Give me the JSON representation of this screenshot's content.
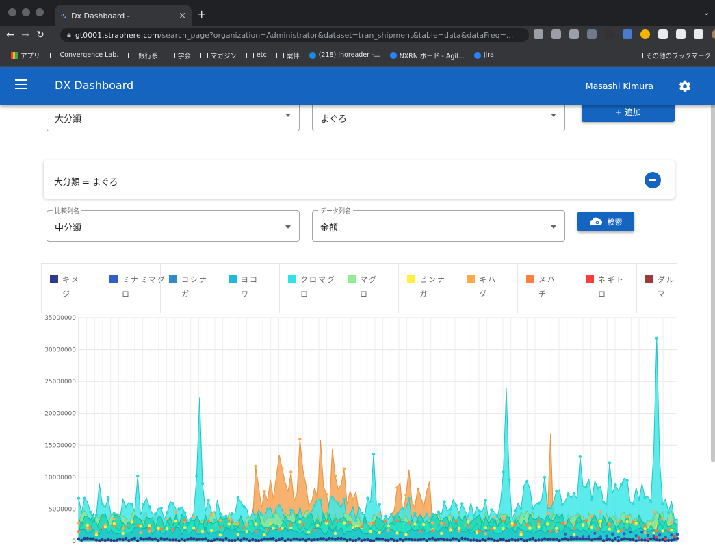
{
  "browser": {
    "tab_title": "Dx Dashboard -",
    "url_host": "gt0001.straphere.com",
    "url_path": "/search_page?organization=Administrator&dataset=tran_shipment&table=data&dataFreq=...",
    "bookmarks": [
      "アプリ",
      "Convergence Lab.",
      "銀行系",
      "学会",
      "マガジン",
      "etc",
      "案件",
      "(218) Inoreader -...",
      "NXRN ボード - Agil...",
      "Jira"
    ],
    "bookmarks_other": "その他のブックマーク"
  },
  "appbar": {
    "title": "DX Dashboard",
    "user": "Masashi Kimura"
  },
  "filters": {
    "column_value": "大分類",
    "value_value": "まぐろ",
    "add_label": "+ 追加",
    "condition": "大分類 = まぐろ",
    "compare_label": "比較列名",
    "compare_value": "中分類",
    "data_label": "データ列名",
    "data_value": "金額",
    "search_label": "検索"
  },
  "colors": {
    "primary": "#1565c0",
    "series": [
      "#2e3a8c",
      "#2f5fbf",
      "#2e8bc8",
      "#1fb8d8",
      "#29e3e6",
      "#90ee90",
      "#fff13c",
      "#ffa94d",
      "#ff7f3f",
      "#ff3b3b",
      "#9a3b3b"
    ]
  },
  "chart_data": {
    "type": "area",
    "legend": [
      {
        "l1": "キメ",
        "l2": "ジ"
      },
      {
        "l1": "ミナミマグ",
        "l2": "ロ"
      },
      {
        "l1": "コシナ",
        "l2": "ガ"
      },
      {
        "l1": "ヨコ",
        "l2": "ワ"
      },
      {
        "l1": "クロマグ",
        "l2": "ロ"
      },
      {
        "l1": "マグ",
        "l2": "ロ"
      },
      {
        "l1": "ビンナ",
        "l2": "ガ"
      },
      {
        "l1": "キハ",
        "l2": "ダ"
      },
      {
        "l1": "メバ",
        "l2": "チ"
      },
      {
        "l1": "ネギト",
        "l2": "ロ"
      },
      {
        "l1": "ダル",
        "l2": "マ"
      }
    ],
    "y_ticks": [
      "35000000",
      "30000000",
      "25000000",
      "20000000",
      "15000000",
      "10000000",
      "5000000",
      "0"
    ],
    "ylim": [
      0,
      35000000
    ],
    "grid": true,
    "series_peaks": {
      "クロマグロ": [
        {
          "i": 7,
          "v": 9000000
        },
        {
          "i": 20,
          "v": 10200000
        },
        {
          "i": 41,
          "v": 22500000
        },
        {
          "i": 100,
          "v": 13600000
        },
        {
          "i": 145,
          "v": 24000000
        },
        {
          "i": 170,
          "v": 13200000
        },
        {
          "i": 180,
          "v": 12300000
        },
        {
          "i": 196,
          "v": 31800000
        }
      ],
      "キハダ": [
        {
          "i": 68,
          "v": 13500000
        },
        {
          "i": 75,
          "v": 16000000
        },
        {
          "i": 82,
          "v": 15800000
        },
        {
          "i": 86,
          "v": 14500000
        },
        {
          "i": 112,
          "v": 11200000
        },
        {
          "i": 160,
          "v": 16800000
        }
      ]
    }
  }
}
